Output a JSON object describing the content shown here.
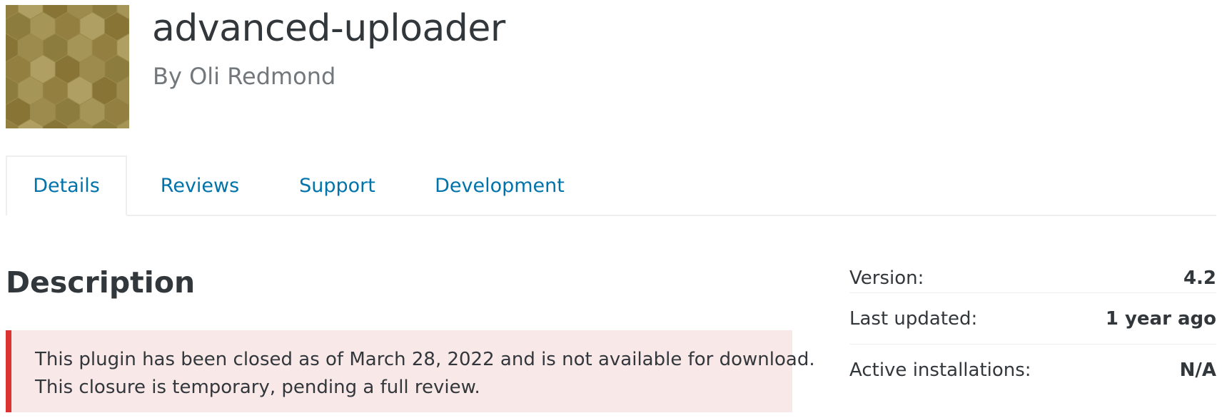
{
  "plugin": {
    "name": "advanced-uploader",
    "author": "By Oli Redmond"
  },
  "tabs": [
    {
      "label": "Details",
      "active": true
    },
    {
      "label": "Reviews",
      "active": false
    },
    {
      "label": "Support",
      "active": false
    },
    {
      "label": "Development",
      "active": false
    }
  ],
  "main": {
    "section_title": "Description",
    "notice": {
      "line1": "This plugin has been closed as of March 28, 2022 and is not available for download.",
      "line2": "This closure is temporary, pending a full review."
    }
  },
  "meta": [
    {
      "label": "Version:",
      "value": "4.2"
    },
    {
      "label": "Last updated:",
      "value": "1 year ago"
    },
    {
      "label": "Active installations:",
      "value": "N/A"
    }
  ],
  "colors": {
    "link": "#0073aa",
    "notice_border": "#dc3232",
    "notice_bg": "#f9e8e8",
    "icon_base": "#9a8a4c"
  }
}
